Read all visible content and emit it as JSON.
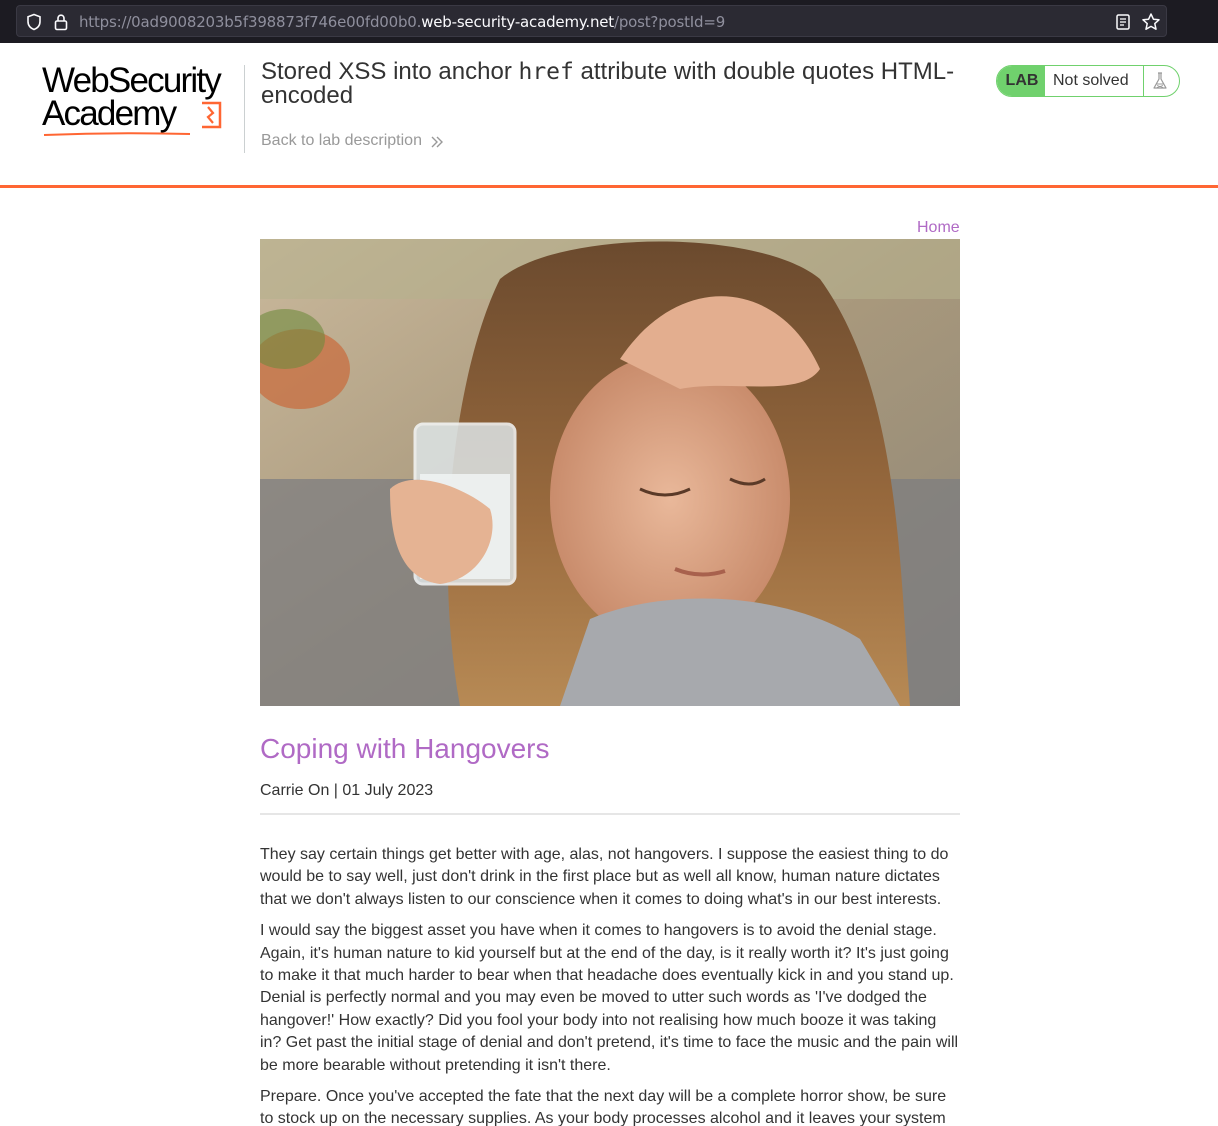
{
  "browser": {
    "url_prefix": "https://0ad9008203b5f398873f746e00fd00b0.",
    "url_host": "web-security-academy.net",
    "url_path": "/post?postId=9",
    "icons": [
      "shield-icon",
      "lock-icon",
      "reader-view-icon",
      "bookmark-star-icon"
    ]
  },
  "header": {
    "logo_line1": "WebSecurity",
    "logo_line2": "Academy",
    "title_part1": "Stored XSS into anchor ",
    "title_code": "href",
    "title_part2": " attribute with double quotes HTML-encoded",
    "back_link": "Back to lab description",
    "lab_badge": "LAB",
    "status": "Not solved",
    "accent_color": "#ff6633",
    "status_color": "#70d16d"
  },
  "nav": {
    "home": "Home"
  },
  "post": {
    "title": "Coping with Hangovers",
    "meta": "Carrie On | 01 July 2023",
    "link_color": "#b06ac5",
    "paragraphs": [
      "They say certain things get better with age, alas, not hangovers. I suppose the easiest thing to do would be to say well, just don't drink in the first place but as well all know, human nature dictates that we don't always listen to our conscience when it comes to doing what's in our best interests.",
      "I would say the biggest asset you have when it comes to hangovers is to avoid the denial stage. Again, it's human nature to kid yourself but at the end of the day, is it really worth it? It's just going to make it that much harder to bear when that headache does eventually kick in and you stand up. Denial is perfectly normal and you may even be moved to utter such words as 'I've dodged the hangover!' How exactly? Did you fool your body into not realising how much booze it was taking in? Get past the initial stage of denial and don't pretend, it's time to face the music and the pain will be more bearable without pretending it isn't there.",
      "Prepare. Once you've accepted the fate that the next day will be a complete horror show, be sure to stock up on the necessary supplies. As your body processes alcohol and it leaves your system"
    ]
  }
}
